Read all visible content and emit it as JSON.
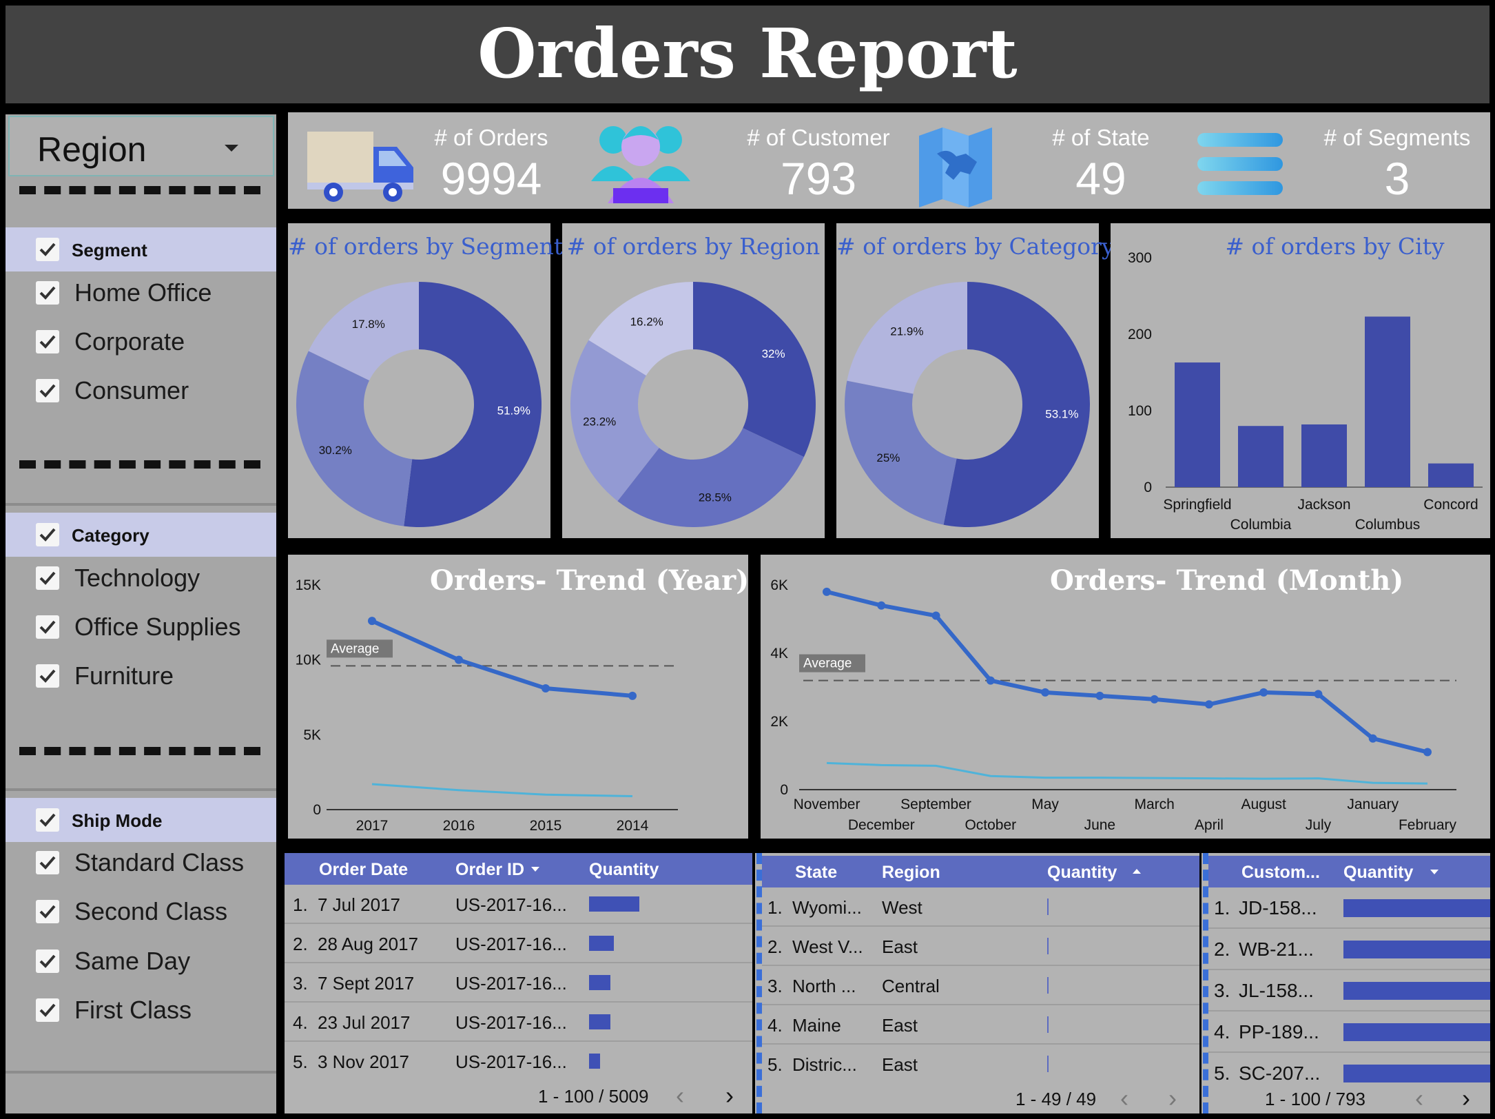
{
  "header": {
    "title": "Orders Report"
  },
  "sidebar": {
    "dropdown": {
      "label": "Region"
    },
    "groups": [
      {
        "title": "Segment",
        "options": [
          "Home Office",
          "Corporate",
          "Consumer"
        ]
      },
      {
        "title": "Category",
        "options": [
          "Technology",
          "Office Supplies",
          "Furniture"
        ]
      },
      {
        "title": "Ship Mode",
        "options": [
          "Standard Class",
          "Second Class",
          "Same Day",
          "First Class"
        ]
      }
    ]
  },
  "kpis": [
    {
      "label": "# of Orders",
      "value": "9994",
      "icon": "truck-icon"
    },
    {
      "label": "# of Customer",
      "value": "793",
      "icon": "customers-icon"
    },
    {
      "label": "# of State",
      "value": "49",
      "icon": "map-icon"
    },
    {
      "label": "# of Segments",
      "value": "3",
      "icon": "segments-icon"
    }
  ],
  "colors": {
    "dark": "#3f4ba8",
    "mid": "#7580c4",
    "light": "#b2b5de",
    "mid2": "#939ad3",
    "lightest": "#c5c7e8",
    "line": "#3568c8",
    "line2": "#4fb3d9",
    "accent_title": "#3a5fcd"
  },
  "chart_data": [
    {
      "type": "pie",
      "title": "# of orders by Segment",
      "labels": [
        "51.9%",
        "30.2%",
        "17.8%"
      ],
      "values": [
        51.9,
        30.2,
        17.8
      ]
    },
    {
      "type": "pie",
      "title": "# of orders by Region",
      "labels": [
        "32%",
        "28.5%",
        "23.2%",
        "16.2%"
      ],
      "values": [
        32,
        28.5,
        23.2,
        16.2
      ]
    },
    {
      "type": "pie",
      "title": "# of orders by Category",
      "labels": [
        "53.1%",
        "25%",
        "21.9%"
      ],
      "values": [
        53.1,
        25,
        21.9
      ]
    },
    {
      "type": "bar",
      "title": "# of orders by City",
      "categories": [
        "Springfield",
        "Columbia",
        "Jackson",
        "Columbus",
        "Concord"
      ],
      "values": [
        163,
        80,
        82,
        223,
        31
      ],
      "ylim": [
        0,
        300
      ],
      "yticks": [
        "0",
        "100",
        "200",
        "300"
      ]
    },
    {
      "type": "line",
      "title": "Orders- Trend (Year)",
      "x": [
        "2017",
        "2016",
        "2015",
        "2014"
      ],
      "series": [
        {
          "values": [
            12600,
            10000,
            8100,
            7600
          ]
        },
        {
          "values": [
            1700,
            1300,
            1000,
            900
          ]
        }
      ],
      "average": 9600,
      "average_label": "Average",
      "ylim": [
        0,
        15000
      ],
      "yticks": [
        "0",
        "5K",
        "10K",
        "15K"
      ]
    },
    {
      "type": "line",
      "title": "Orders- Trend (Month)",
      "x": [
        "November",
        "December",
        "September",
        "October",
        "May",
        "June",
        "March",
        "April",
        "August",
        "July",
        "January",
        "February"
      ],
      "series": [
        {
          "values": [
            5800,
            5400,
            5100,
            3200,
            2850,
            2750,
            2650,
            2500,
            2850,
            2800,
            1500,
            1100
          ]
        },
        {
          "values": [
            780,
            720,
            700,
            400,
            350,
            350,
            340,
            330,
            320,
            330,
            200,
            180
          ]
        }
      ],
      "average": 3200,
      "average_label": "Average",
      "ylim": [
        0,
        6000
      ],
      "yticks": [
        "0",
        "2K",
        "4K",
        "6K"
      ]
    }
  ],
  "tables": {
    "orders": {
      "headers": [
        "Order Date",
        "Order ID",
        "Quantity"
      ],
      "rows": [
        {
          "num": "1.",
          "date": "7 Jul 2017",
          "id": "US-2017-16...",
          "qty": 14
        },
        {
          "num": "2.",
          "date": "28 Aug 2017",
          "id": "US-2017-16...",
          "qty": 7
        },
        {
          "num": "3.",
          "date": "7 Sept 2017",
          "id": "US-2017-16...",
          "qty": 6
        },
        {
          "num": "4.",
          "date": "23 Jul 2017",
          "id": "US-2017-16...",
          "qty": 6
        },
        {
          "num": "5.",
          "date": "3 Nov 2017",
          "id": "US-2017-16...",
          "qty": 3
        }
      ],
      "pager": "1 - 100 / 5009"
    },
    "states": {
      "headers": [
        "State",
        "Region",
        "Quantity"
      ],
      "rows": [
        {
          "num": "1.",
          "state": "Wyomi...",
          "region": "West"
        },
        {
          "num": "2.",
          "state": "West V...",
          "region": "East"
        },
        {
          "num": "3.",
          "state": "North ...",
          "region": "Central"
        },
        {
          "num": "4.",
          "state": "Maine",
          "region": "East"
        },
        {
          "num": "5.",
          "state": "Distric...",
          "region": "East"
        }
      ],
      "pager": "1 - 49 / 49"
    },
    "customers": {
      "headers": [
        "Custom...",
        "Quantity"
      ],
      "rows": [
        {
          "num": "1.",
          "id": "JD-158..."
        },
        {
          "num": "2.",
          "id": "WB-21..."
        },
        {
          "num": "3.",
          "id": "JL-158..."
        },
        {
          "num": "4.",
          "id": "PP-189..."
        },
        {
          "num": "5.",
          "id": "SC-207..."
        }
      ],
      "pager": "1 - 100 / 793"
    }
  }
}
